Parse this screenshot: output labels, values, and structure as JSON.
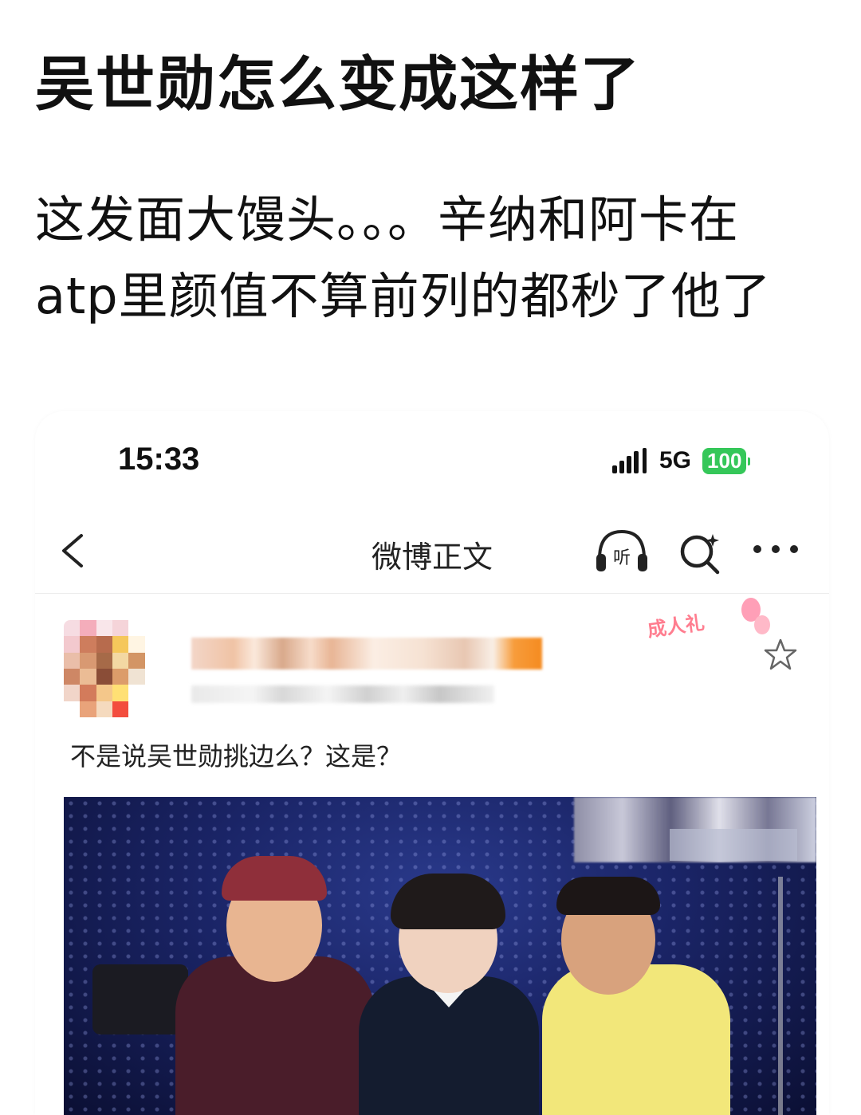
{
  "post": {
    "title": "吴世勋怎么变成这样了",
    "body_lines": [
      "这发面大馒头。。。辛纳和阿卡在",
      "atp里颜值不算前列的都秒了他了"
    ]
  },
  "screenshot": {
    "status_bar": {
      "time": "15:33",
      "network": "5G",
      "battery": "100"
    },
    "nav": {
      "back_icon": "chevron-left-icon",
      "title": "微博正文",
      "listen_label": "听",
      "search_icon": "search-sparkle-icon",
      "more_icon": "more-dots-icon"
    },
    "weibo_post": {
      "badge_text": "成人礼",
      "text": "不是说吴世勋挑边么？这是？",
      "colors": {
        "badge": "#ff7d8f",
        "battery": "#35c759"
      }
    }
  }
}
